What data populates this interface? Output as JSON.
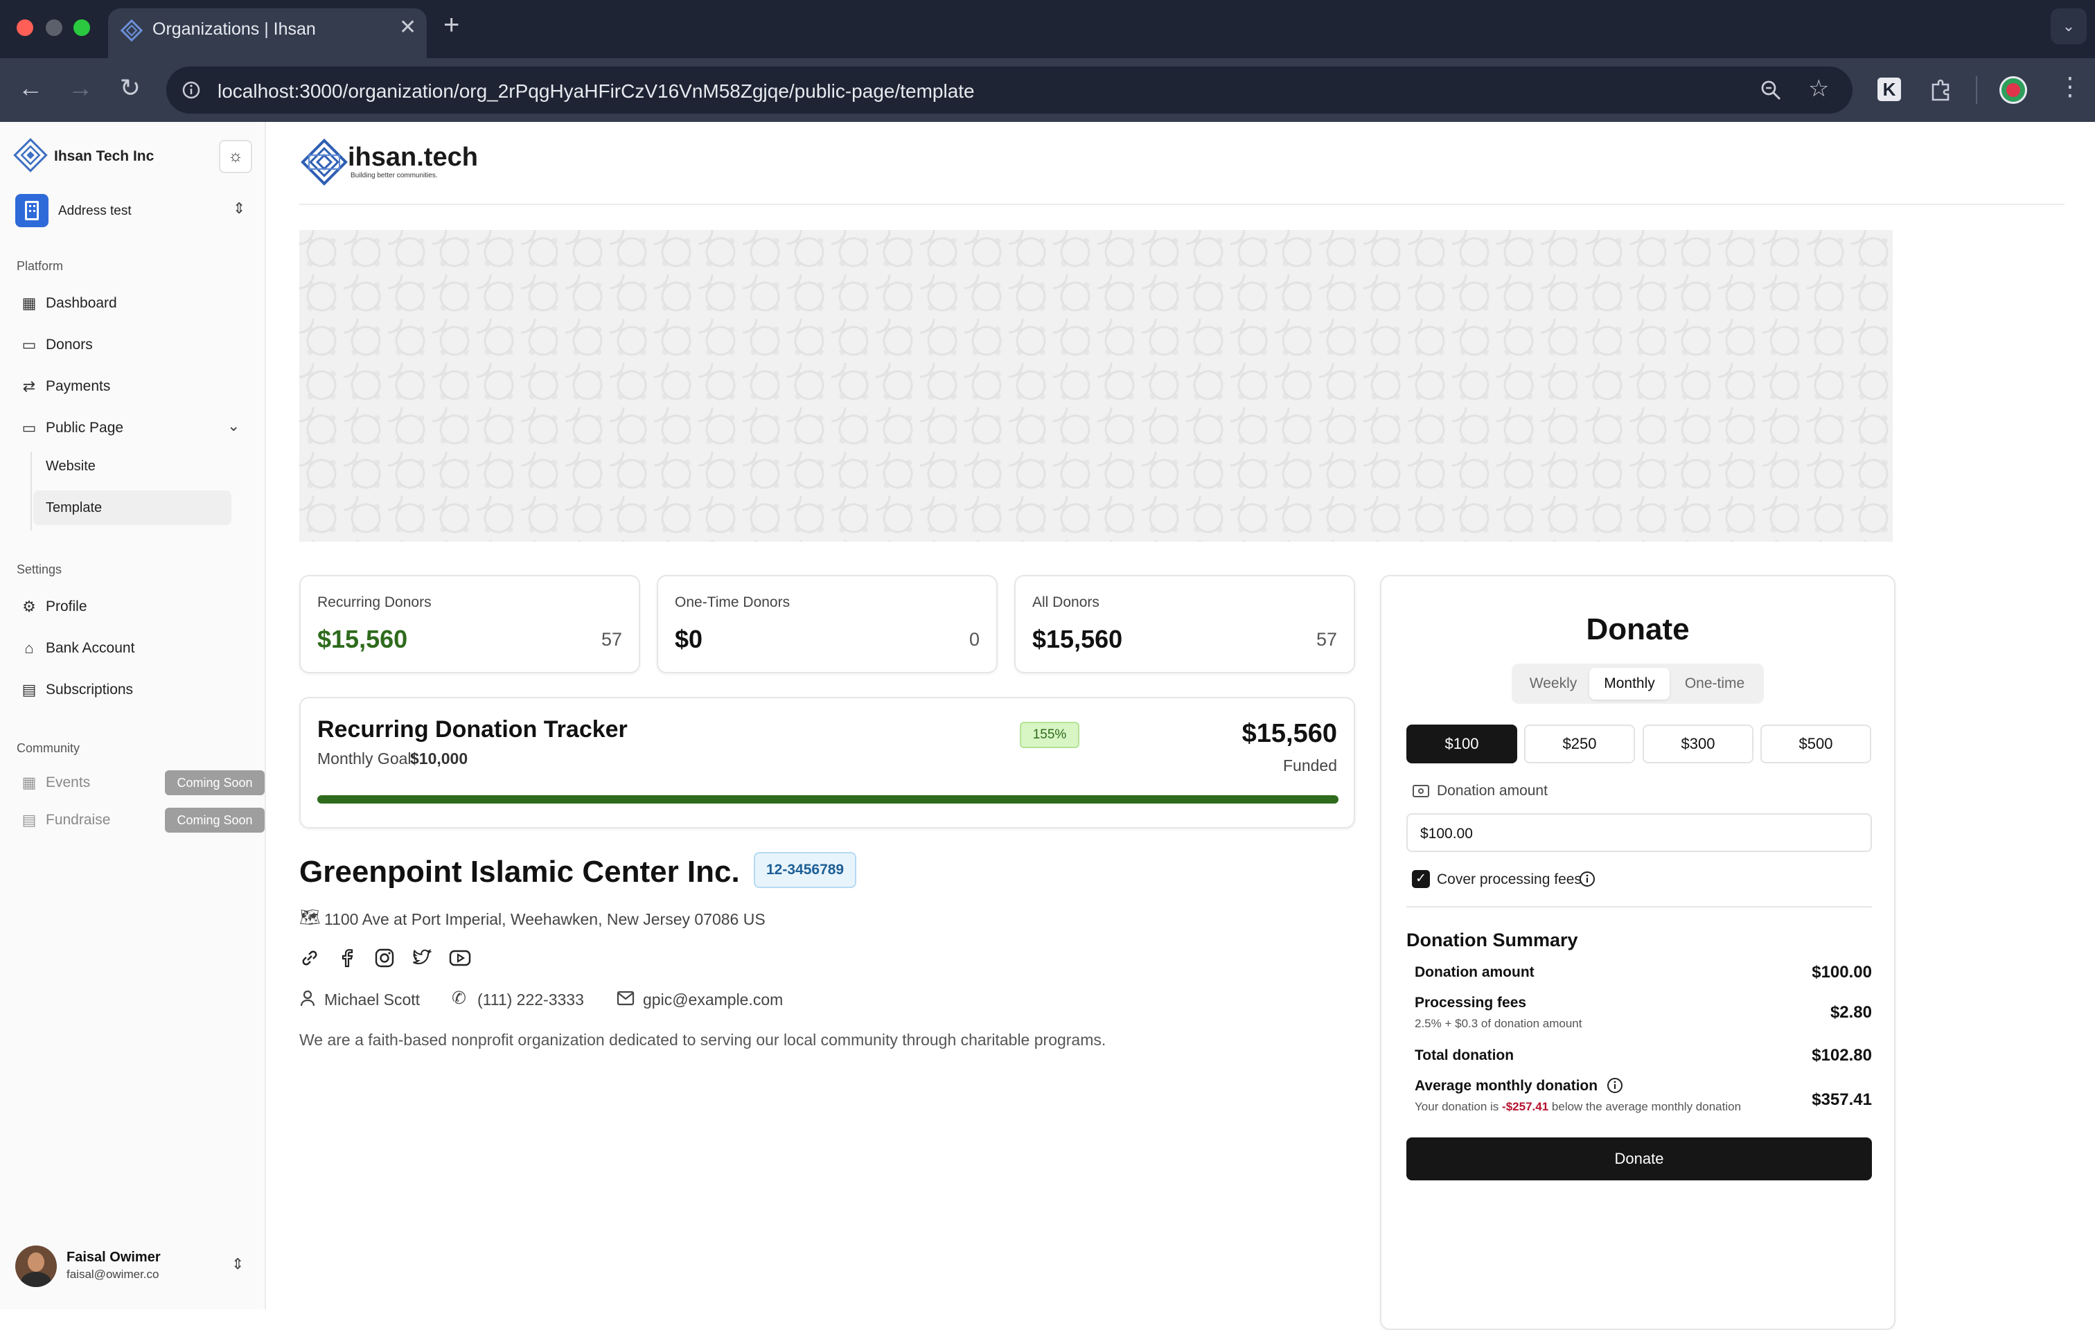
{
  "browser": {
    "tab_title": "Organizations | Ihsan",
    "url": "localhost:3000/organization/org_2rPqgHyaHFirCzV16VnM58Zgjqe/public-page/template",
    "new_tab": "+",
    "close": "✕"
  },
  "sidebar": {
    "org_name": "Ihsan Tech Inc",
    "workspace": "Address test",
    "platform_title": "Platform",
    "platform_items": [
      {
        "label": "Dashboard",
        "icon": "dashboard-icon"
      },
      {
        "label": "Donors",
        "icon": "donors-icon"
      },
      {
        "label": "Payments",
        "icon": "payments-icon"
      },
      {
        "label": "Public Page",
        "icon": "public-page-icon"
      }
    ],
    "public_page_sub": [
      "Website",
      "Template"
    ],
    "settings_title": "Settings",
    "settings_items": [
      {
        "label": "Profile",
        "icon": "gear-icon"
      },
      {
        "label": "Bank Account",
        "icon": "bank-icon"
      },
      {
        "label": "Subscriptions",
        "icon": "subscriptions-icon"
      }
    ],
    "community_title": "Community",
    "community_items": [
      {
        "label": "Events",
        "badge": "Coming Soon"
      },
      {
        "label": "Fundraise",
        "badge": "Coming Soon"
      }
    ],
    "user": {
      "name": "Faisal Owimer",
      "email": "faisal@owimer.co"
    }
  },
  "header": {
    "brand": "ihsan.tech",
    "tagline": "Building better communities."
  },
  "stats": [
    {
      "label": "Recurring Donors",
      "amount": "$15,560",
      "count": "57",
      "color": "#2e6b1c"
    },
    {
      "label": "One-Time Donors",
      "amount": "$0",
      "count": "0",
      "color": "#111111"
    },
    {
      "label": "All Donors",
      "amount": "$15,560",
      "count": "57",
      "color": "#111111"
    }
  ],
  "tracker": {
    "title": "Recurring Donation Tracker",
    "goal_label": "Monthly Goal:",
    "goal_value": "$10,000",
    "percent_badge": "155%",
    "funded_amount": "$15,560",
    "funded_label": "Funded",
    "progress": 1.0
  },
  "org": {
    "name": "Greenpoint Islamic Center Inc.",
    "ein": "12-3456789",
    "address": "1100 Ave at Port Imperial, Weehawken, New Jersey 07086 US",
    "contact_name": "Michael Scott",
    "phone": "(111) 222-3333",
    "email": "gpic@example.com",
    "description": "We are a faith-based nonprofit organization dedicated to serving our local community through charitable programs."
  },
  "donate": {
    "title": "Donate",
    "frequencies": [
      "Weekly",
      "Monthly",
      "One-time"
    ],
    "selected_frequency": "Monthly",
    "amounts": [
      "$100",
      "$250",
      "$300",
      "$500"
    ],
    "selected_amount": "$100",
    "amount_label": "Donation amount",
    "amount_value": "$100.00",
    "cover_fees_label": "Cover processing fees",
    "cover_fees_checked": true,
    "summary_title": "Donation Summary",
    "rows": {
      "donation_label": "Donation amount",
      "donation_value": "$100.00",
      "fees_label": "Processing fees",
      "fees_value": "$2.80",
      "fees_sub": "2.5% + $0.3 of donation amount",
      "total_label": "Total donation",
      "total_value": "$102.80",
      "avg_label": "Average monthly donation",
      "avg_value": "$357.41",
      "avg_sub_pre": "Your donation is",
      "avg_sub_diff": "-$257.41",
      "avg_sub_post": "below the average monthly donation"
    },
    "button": "Donate"
  }
}
